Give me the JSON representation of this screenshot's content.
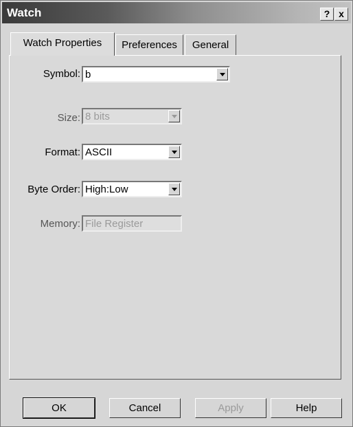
{
  "window": {
    "title": "Watch",
    "help_button": "?",
    "close_button": "x"
  },
  "tabs": [
    {
      "label": "Watch Properties",
      "active": true
    },
    {
      "label": "Preferences",
      "active": false
    },
    {
      "label": "General",
      "active": false
    }
  ],
  "fields": {
    "symbol": {
      "label": "Symbol:",
      "value": "b",
      "enabled": true
    },
    "size": {
      "label": "Size:",
      "value": "8 bits",
      "enabled": false
    },
    "format": {
      "label": "Format:",
      "value": "ASCII",
      "enabled": true
    },
    "byte_order": {
      "label": "Byte Order:",
      "value": "High:Low",
      "enabled": true
    },
    "memory": {
      "label": "Memory:",
      "value": "File Register",
      "enabled": false
    }
  },
  "buttons": {
    "ok": "OK",
    "cancel": "Cancel",
    "apply": "Apply",
    "help": "Help"
  }
}
